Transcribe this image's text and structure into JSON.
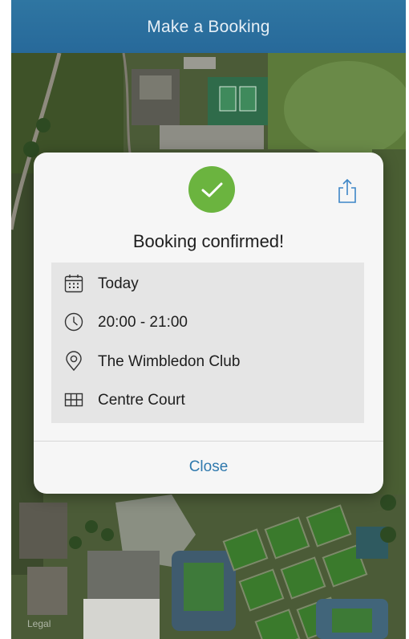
{
  "header": {
    "title": "Make a Booking"
  },
  "map": {
    "legal_label": "Legal"
  },
  "dialog": {
    "title": "Booking confirmed!",
    "details": [
      {
        "icon": "calendar-icon",
        "label": "Today"
      },
      {
        "icon": "clock-icon",
        "label": "20:00 - 21:00"
      },
      {
        "icon": "location-pin-icon",
        "label": "The Wimbledon Club"
      },
      {
        "icon": "court-grid-icon",
        "label": "Centre Court"
      }
    ],
    "close_label": "Close"
  },
  "colors": {
    "header_bar": "#2a6f9e",
    "success_green": "#6bb43f",
    "link_blue": "#2f79ad"
  }
}
